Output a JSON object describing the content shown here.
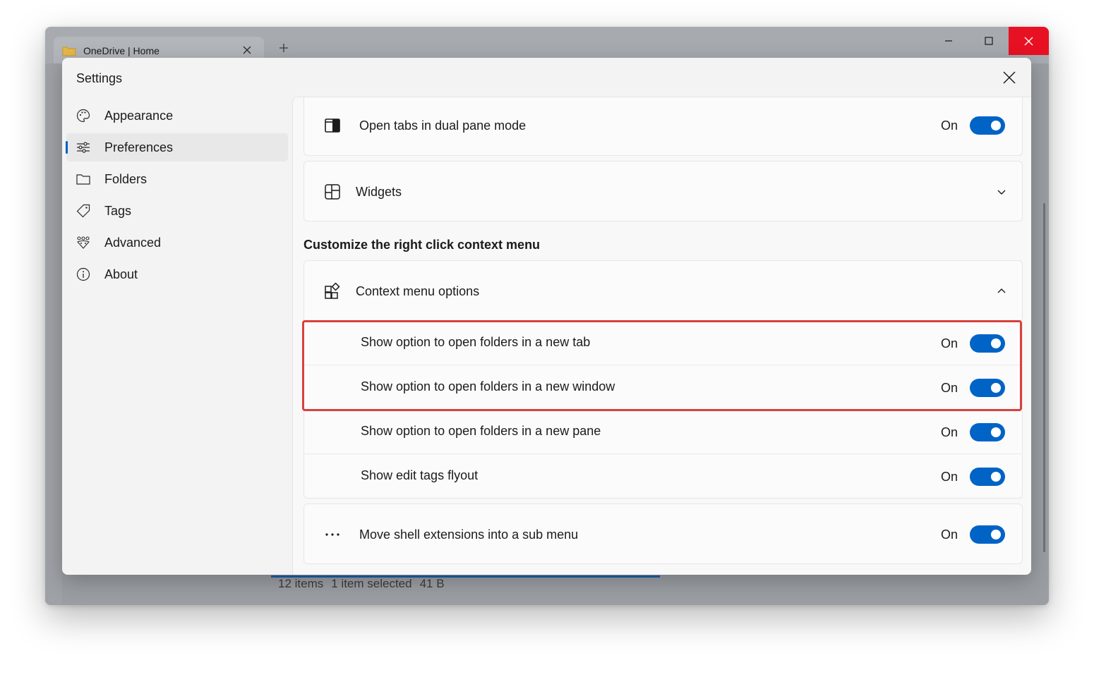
{
  "app": {
    "tab_title": "OneDrive | Home",
    "new_tab_symbol": "+",
    "status": {
      "items": "12 items",
      "selected": "1 item selected",
      "size": "41 B"
    }
  },
  "dialog": {
    "title": "Settings",
    "nav": [
      {
        "label": "Appearance",
        "icon": "palette-icon",
        "active": false
      },
      {
        "label": "Preferences",
        "icon": "sliders-icon",
        "active": true
      },
      {
        "label": "Folders",
        "icon": "folder-icon",
        "active": false
      },
      {
        "label": "Tags",
        "icon": "tag-icon",
        "active": false
      },
      {
        "label": "Advanced",
        "icon": "advanced-icon",
        "active": false
      },
      {
        "label": "About",
        "icon": "info-icon",
        "active": false
      }
    ],
    "settings": {
      "dual_pane": {
        "label": "Open tabs in dual pane mode",
        "state": "On",
        "on": true,
        "icon": "dual-pane-icon"
      },
      "widgets": {
        "label": "Widgets",
        "icon": "widgets-icon",
        "expanded": false
      },
      "context_heading": "Customize the right click context menu",
      "context_options": {
        "label": "Context menu options",
        "icon": "context-menu-icon",
        "expanded": true
      },
      "sub_options": [
        {
          "label": "Show option to open folders in a new tab",
          "state": "On",
          "on": true,
          "highlighted": true
        },
        {
          "label": "Show option to open folders in a new window",
          "state": "On",
          "on": true,
          "highlighted": true
        },
        {
          "label": "Show option to open folders in a new pane",
          "state": "On",
          "on": true,
          "highlighted": false
        },
        {
          "label": "Show edit tags flyout",
          "state": "On",
          "on": true,
          "highlighted": false
        }
      ],
      "shell_extensions": {
        "label": "Move shell extensions into a sub menu",
        "state": "On",
        "on": true,
        "icon": "more-icon"
      }
    }
  },
  "colors": {
    "accent": "#0063c6",
    "highlight_border": "#d9403e",
    "close_button": "#e81123"
  }
}
